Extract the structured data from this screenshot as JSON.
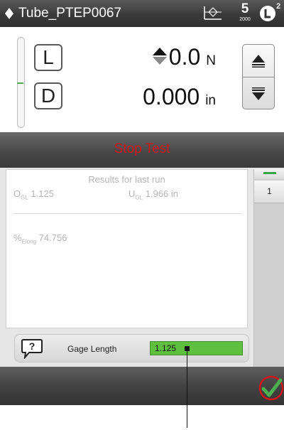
{
  "title_bar": {
    "title": "Tube_PTEP0067",
    "method_badge_number": "5",
    "method_badge_caption": "2000",
    "user_level": "2",
    "icons": [
      "diamond-up-down-icon",
      "gage-length-icon",
      "method-5-icon",
      "lock-level-icon"
    ]
  },
  "readout": {
    "load_button": "L",
    "displacement_button": "D",
    "load_value": "0.0",
    "load_unit": "N",
    "displacement_value": "0.000",
    "displacement_unit": "in",
    "icons": [
      "up-down-triangle-icon",
      "jog-up-icon",
      "jog-down-icon"
    ]
  },
  "stop_test": {
    "label": "Stop Test",
    "color": "#d2161c"
  },
  "results": {
    "heading": "Results for last run",
    "ogl_symbol": "O",
    "ogl_sub": "GL",
    "ogl_value": "1.125",
    "ugl_symbol": "U",
    "ugl_sub": "GL",
    "ugl_value": "1.966 in",
    "elong_symbol": "%",
    "elong_sub": "Elong",
    "elong_value": "74.756"
  },
  "side_tabs": {
    "tab_1": "1"
  },
  "gage": {
    "label": "Gage Length",
    "value": "1.125",
    "field_color": "#5fbf3f"
  },
  "bottom_bar": {
    "icons": [
      "accept-check-icon"
    ]
  }
}
